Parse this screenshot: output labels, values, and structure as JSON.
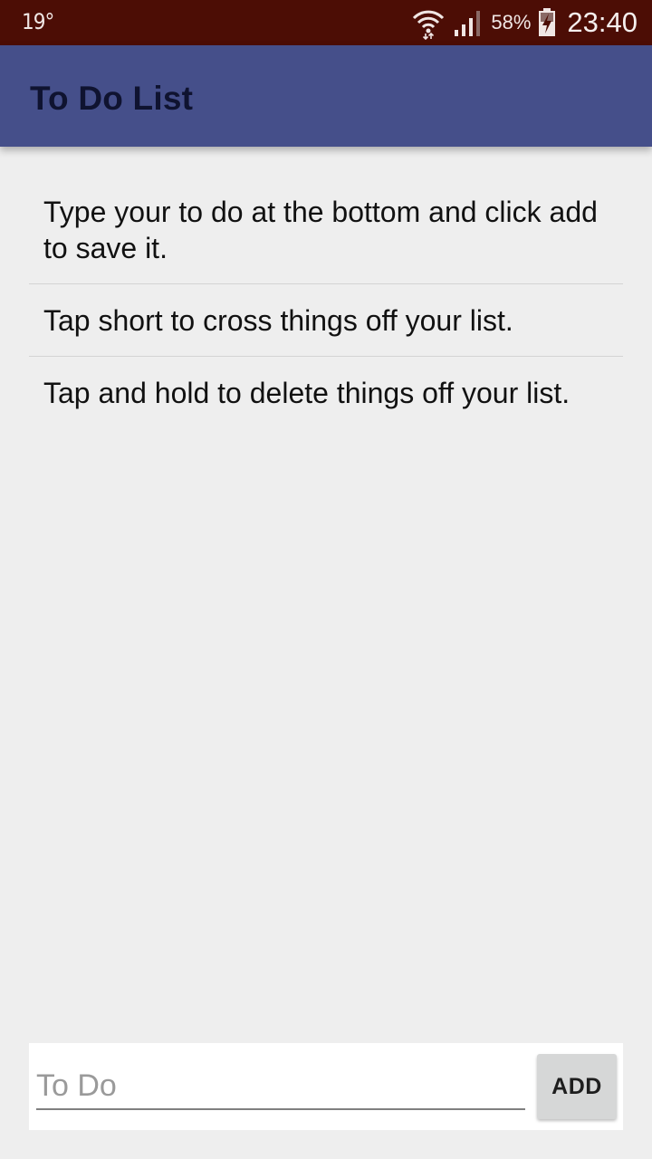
{
  "status_bar": {
    "temperature": "19°",
    "battery_percent": "58%",
    "time": "23:40",
    "icons": [
      "wifi-icon",
      "signal-icon",
      "battery-charging-icon"
    ]
  },
  "app_bar": {
    "title": "To Do List",
    "color": "#454f8a"
  },
  "todo_list": {
    "items": [
      {
        "text": "Type your to do at the bottom and click add to save it."
      },
      {
        "text": "Tap short to cross things off your list."
      },
      {
        "text": "Tap and hold to delete things off your list."
      }
    ]
  },
  "input_bar": {
    "value": "",
    "placeholder": "To Do",
    "add_label": "ADD"
  }
}
